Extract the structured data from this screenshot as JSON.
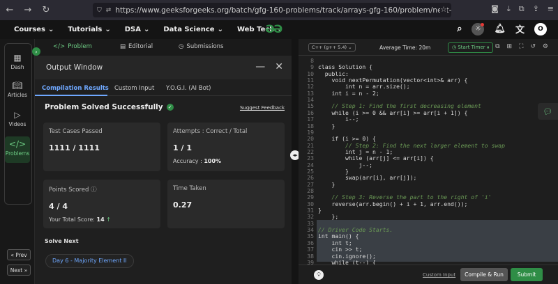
{
  "browser": {
    "url": "https://www.geeksforgeeks.org/batch/gfg-160-problems/track/arrays-gfg-160/problem/next-permutation52"
  },
  "nav": {
    "menus": [
      "Courses",
      "Tutorials",
      "DSA",
      "Data Science",
      "Web Tech"
    ],
    "avatar_letter": "O"
  },
  "rail": {
    "items": [
      "Dash",
      "Articles",
      "Videos",
      "Problems"
    ],
    "prev": "Prev",
    "next": "Next"
  },
  "problem_tabs": [
    "Problem",
    "Editorial",
    "Submissions"
  ],
  "output": {
    "title": "Output Window",
    "tabs": [
      "Compilation Results",
      "Custom Input",
      "Y.O.G.I. (AI Bot)"
    ],
    "status": "Problem Solved Successfully",
    "feedback": "Suggest Feedback",
    "test_cases_label": "Test Cases Passed",
    "test_cases_value": "1111 / 1111",
    "attempts_label": "Attempts : Correct / Total",
    "attempts_value": "1 / 1",
    "accuracy_label": "Accuracy :",
    "accuracy_value": "100%",
    "points_label": "Points Scored",
    "points_value": "4 / 4",
    "total_score_label": "Your Total Score:",
    "total_score_value": "14",
    "time_label": "Time Taken",
    "time_value": "0.27",
    "solve_next": "Solve Next",
    "next_problem": "Day 6 - Majority Element II"
  },
  "editor": {
    "language": "C++ (g++ 5.4)",
    "avg_time": "Average Time: 20m",
    "timer": "Start Timer",
    "custom_input": "Custom Input",
    "compile": "Compile & Run",
    "submit": "Submit",
    "lines": [
      {
        "n": "8",
        "t": ""
      },
      {
        "n": "9",
        "t": "class Solution {"
      },
      {
        "n": "10",
        "t": "  public:"
      },
      {
        "n": "11",
        "t": "    void nextPermutation(vector<int>& arr) {"
      },
      {
        "n": "12",
        "t": "        int n = arr.size();"
      },
      {
        "n": "13",
        "t": "    int i = n - 2;"
      },
      {
        "n": "14",
        "t": ""
      },
      {
        "n": "15",
        "t": "    // Step 1: Find the first decreasing element"
      },
      {
        "n": "16",
        "t": "    while (i >= 0 && arr[i] >= arr[i + 1]) {"
      },
      {
        "n": "17",
        "t": "        i--;"
      },
      {
        "n": "18",
        "t": "    }"
      },
      {
        "n": "19",
        "t": ""
      },
      {
        "n": "20",
        "t": "    if (i >= 0) {"
      },
      {
        "n": "21",
        "t": "        // Step 2: Find the next larger element to swap"
      },
      {
        "n": "22",
        "t": "        int j = n - 1;"
      },
      {
        "n": "23",
        "t": "        while (arr[j] <= arr[i]) {"
      },
      {
        "n": "24",
        "t": "            j--;"
      },
      {
        "n": "25",
        "t": "        }"
      },
      {
        "n": "26",
        "t": "        swap(arr[i], arr[j]);"
      },
      {
        "n": "27",
        "t": "    }"
      },
      {
        "n": "28",
        "t": ""
      },
      {
        "n": "29",
        "t": "    // Step 3: Reverse the part to the right of 'i'"
      },
      {
        "n": "30",
        "t": "    reverse(arr.begin() + i + 1, arr.end());"
      },
      {
        "n": "31",
        "t": "}"
      },
      {
        "n": "32",
        "t": "    };"
      },
      {
        "n": "33",
        "t": ""
      },
      {
        "n": "34",
        "t": "// Driver Code Starts."
      },
      {
        "n": "35",
        "t": "int main() {"
      },
      {
        "n": "36",
        "t": "    int t;"
      },
      {
        "n": "37",
        "t": "    cin >> t;"
      },
      {
        "n": "38",
        "t": "    cin.ignore();"
      },
      {
        "n": "39",
        "t": "    while (t--) {"
      }
    ]
  }
}
